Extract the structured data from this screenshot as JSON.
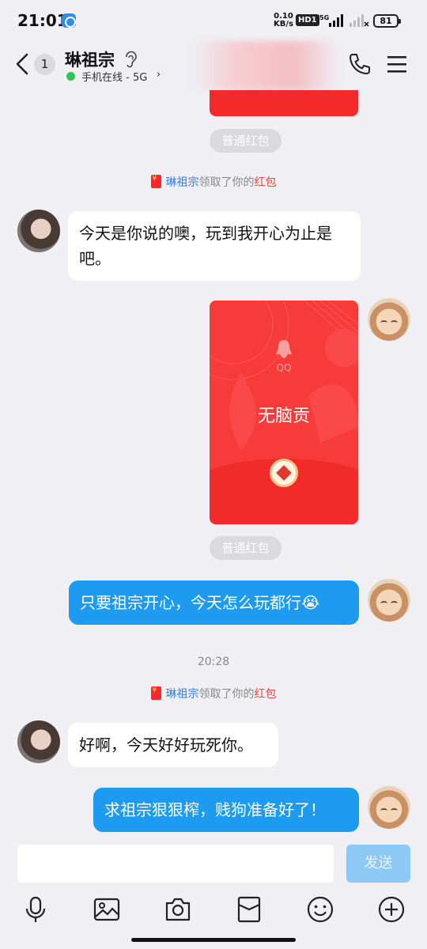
{
  "status_bar": {
    "time": "21:01",
    "speed_value": "0.10",
    "speed_unit": "KB/s",
    "hd": "HD1",
    "network": "5G",
    "battery": "81"
  },
  "header": {
    "unread_count": "1",
    "contact_name": "琳祖宗",
    "status": "手机在线 - 5G",
    "status_arrow": "›"
  },
  "messages": {
    "pill_label": "普通红包",
    "system_received": {
      "name": "琳祖宗",
      "middle": "领取了你的",
      "red": "红包"
    },
    "msg1": "今天是你说的噢，玩到我开心为止是吧。",
    "red_packet": {
      "brand": "QQ",
      "label": "无脑贡"
    },
    "msg2": "只要祖宗开心，今天怎么玩都行😭",
    "timestamp": "20:28",
    "msg3": "好啊，今天好好玩死你。",
    "msg4": "求祖宗狠狠榨，贱狗准备好了！"
  },
  "input": {
    "send_label": "发送",
    "placeholder": ""
  },
  "colors": {
    "bubble_out": "#1d9bf0",
    "red_packet": "#f42a2a",
    "online": "#35c15b"
  },
  "toolbar": {
    "icons": [
      "microphone-icon",
      "image-icon",
      "camera-icon",
      "red-packet-icon",
      "emoji-icon",
      "plus-icon"
    ]
  }
}
